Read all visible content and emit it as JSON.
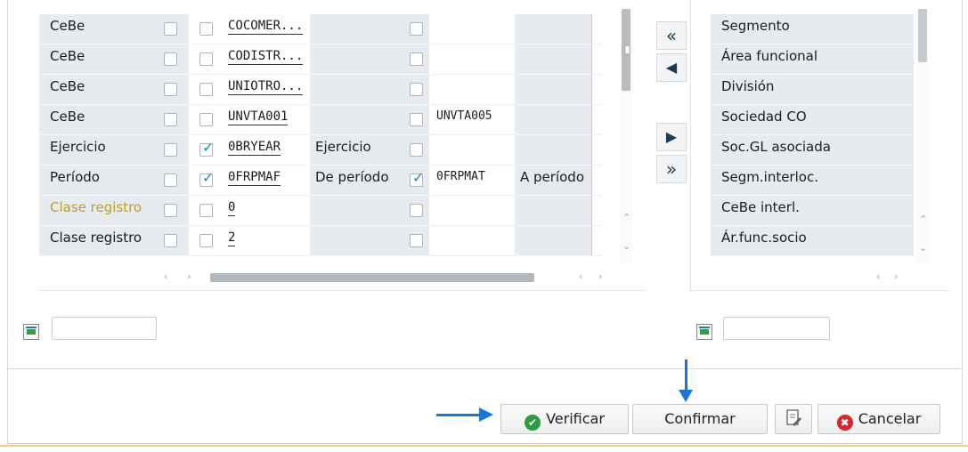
{
  "rows": [
    {
      "name": "CeBe",
      "cb1": false,
      "cb2": false,
      "field": "COCOMER...",
      "text": "",
      "cb3": false,
      "field2": "",
      "text2": "",
      "name_style": "normal"
    },
    {
      "name": "CeBe",
      "cb1": false,
      "cb2": false,
      "field": "CODISTR...",
      "text": "",
      "cb3": false,
      "field2": "",
      "text2": "",
      "name_style": "normal"
    },
    {
      "name": "CeBe",
      "cb1": false,
      "cb2": false,
      "field": "UNIOTRO...",
      "text": "",
      "cb3": false,
      "field2": "",
      "text2": "",
      "name_style": "normal"
    },
    {
      "name": "CeBe",
      "cb1": false,
      "cb2": false,
      "field": "UNVTA001",
      "text": "",
      "cb3": false,
      "field2": "UNVTA005",
      "text2": "",
      "name_style": "normal"
    },
    {
      "name": "Ejercicio",
      "cb1": false,
      "cb2": true,
      "field": "0BRYEAR",
      "text": "Ejercicio",
      "cb3": false,
      "field2": "",
      "text2": "",
      "name_style": "normal"
    },
    {
      "name": "Período",
      "cb1": false,
      "cb2": true,
      "field": "0FRPMAF",
      "text": "De período",
      "cb3": true,
      "field2": "0FRPMAT",
      "text2": "A período",
      "name_style": "normal"
    },
    {
      "name": "Clase registro",
      "cb1": false,
      "cb2": false,
      "field": "0",
      "text": "",
      "cb3": false,
      "field2": "",
      "text2": "",
      "name_style": "yellow"
    },
    {
      "name": "Clase registro",
      "cb1": false,
      "cb2": false,
      "field": "2",
      "text": "",
      "cb3": false,
      "field2": "",
      "text2": "",
      "name_style": "normal"
    }
  ],
  "move_buttons": {
    "move_all_left": "«",
    "move_left": "◀",
    "move_right": "▶",
    "move_all_right": "»"
  },
  "right_list": [
    "Segmento",
    "Área funcional",
    "División",
    "Sociedad CO",
    "Soc.GL asociada",
    "Segm.interloc.",
    "CeBe interl.",
    "Ár.func.socio"
  ],
  "left_filter": {
    "value": "",
    "icon": "filter-icon"
  },
  "right_filter": {
    "value": "",
    "icon": "filter-icon"
  },
  "buttons": {
    "verify": "Verificar",
    "confirm": "Confirmar",
    "cancel": "Cancelar"
  },
  "icons": {
    "verify": "check-circle-icon",
    "cancel": "x-circle-icon",
    "doc": "document-edit-icon"
  },
  "colors": {
    "accent_arrow": "#1877d6",
    "check": "#1d8fb0",
    "ok_green": "#2e9d3f",
    "cancel_red": "#d4282c",
    "yellow_label": "#b8a22d"
  }
}
